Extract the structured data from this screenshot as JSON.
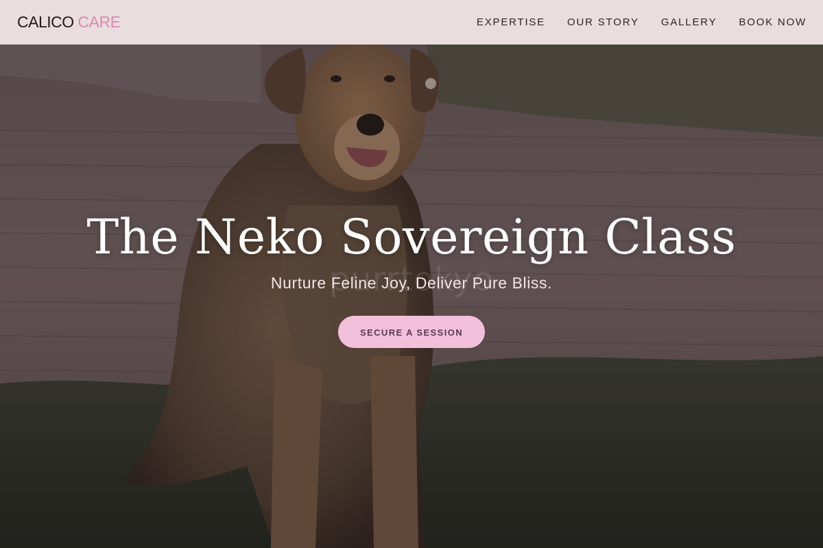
{
  "brand": {
    "logo_part_1": "CALICO",
    "logo_part_2": "CARE",
    "accent_color": "#d98bb0"
  },
  "nav": {
    "items": [
      {
        "label": "EXPERTISE"
      },
      {
        "label": "OUR STORY"
      },
      {
        "label": "GALLERY"
      },
      {
        "label": "BOOK NOW"
      }
    ]
  },
  "hero": {
    "title": "The Neko Sovereign Class",
    "subtitle": "Nurture Feline Joy, Deliver Pure Bliss.",
    "watermark": "purrtokyo",
    "cta_label": "SECURE A SESSION",
    "cta_color": "#f3c0dc",
    "background_image": "dog-sitting-on-grass-photo"
  }
}
